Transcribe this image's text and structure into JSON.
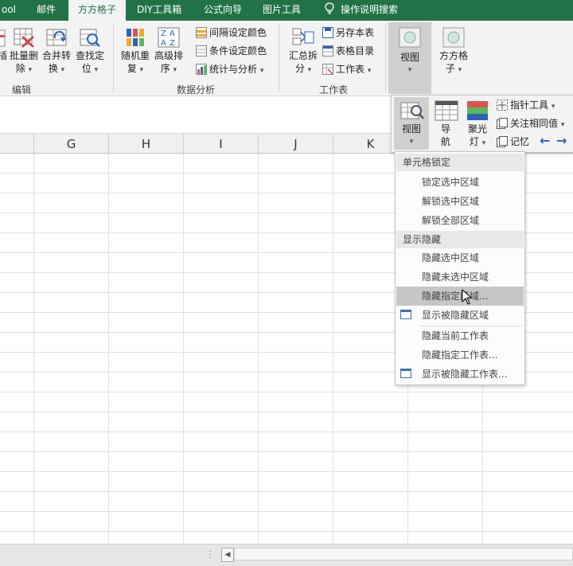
{
  "tabs": [
    {
      "label": "ool"
    },
    {
      "label": "邮件"
    },
    {
      "label": "方方格子",
      "active": true
    },
    {
      "label": "DIY工具箱"
    },
    {
      "label": "公式向导"
    },
    {
      "label": "图片工具"
    }
  ],
  "tell_me": {
    "label": "操作说明搜索"
  },
  "ribbon": {
    "edit_group": {
      "label": "编辑",
      "partial_label": "插",
      "buttons": [
        {
          "line1": "批量删",
          "line2": "除"
        },
        {
          "line1": "合并转",
          "line2": "换"
        },
        {
          "line1": "查找定",
          "line2": "位"
        }
      ]
    },
    "analysis_group": {
      "label": "数据分析",
      "buttons": [
        {
          "line1": "随机重",
          "line2": "复"
        },
        {
          "line1": "高级排",
          "line2": "序"
        }
      ],
      "small_buttons": [
        {
          "label": "间隔设定颜色"
        },
        {
          "label": "条件设定颜色"
        },
        {
          "label": "统计与分析"
        }
      ]
    },
    "sheet_group": {
      "label": "工作表",
      "buttons": [
        {
          "line1": "汇总拆",
          "line2": "分"
        }
      ],
      "small_buttons": [
        {
          "label": "另存本表"
        },
        {
          "label": "表格目录"
        },
        {
          "label": "工作表"
        }
      ]
    },
    "view_button": {
      "label": "视图"
    },
    "fangfang_button": {
      "line1": "方方格",
      "line2": "子"
    }
  },
  "columns": [
    "G",
    "H",
    "I",
    "J",
    "K"
  ],
  "popup_toolbar": {
    "view": {
      "label": "视图"
    },
    "nav": {
      "line1": "导",
      "line2": "航"
    },
    "spotlight": {
      "line1": "聚光",
      "line2": "灯"
    },
    "pointer_tool": {
      "label": "指针工具"
    },
    "focus_same": {
      "label": "关注相同值"
    },
    "memory": {
      "label": "记忆"
    }
  },
  "menu": {
    "section1": "单元格锁定",
    "lock_selection": "锁定选中区域",
    "unlock_selection": "解锁选中区域",
    "unlock_all": "解锁全部区域",
    "section2": "显示隐藏",
    "hide_selection": "隐藏选中区域",
    "hide_unselected": "隐藏未选中区域",
    "hide_specified": "隐藏指定区域...",
    "show_hidden_area": "显示被隐藏区域",
    "hide_current_sheet": "隐藏当前工作表",
    "hide_specified_sheet": "隐藏指定工作表...",
    "show_hidden_sheet": "显示被隐藏工作表..."
  },
  "colors": {
    "tab_bar": "#217346",
    "ribbon": "#f3f3f3",
    "menu_highlight": "#c6c6c6",
    "arrow_blue": "#2b63b8"
  }
}
